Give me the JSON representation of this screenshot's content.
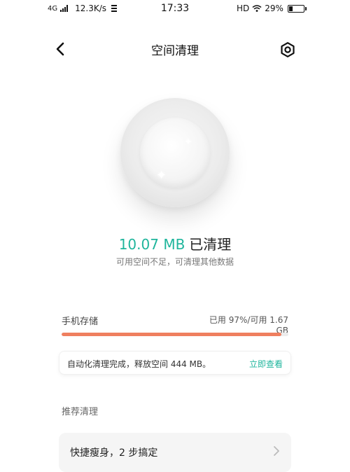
{
  "status_bar": {
    "network": "4G",
    "speed": "12.3K/s",
    "time": "17:33",
    "hd": "HD",
    "battery": "29%"
  },
  "header": {
    "title": "空间清理",
    "back_icon": "chevron-left-icon",
    "settings_icon": "gear-icon"
  },
  "result": {
    "amount": "10.07 MB",
    "suffix": "已清理",
    "subtitle": "可用空间不足，可清理其他数据"
  },
  "storage": {
    "label": "手机存储",
    "stats": "已用 97%/可用 1.67 GB",
    "used_fraction": 0.97
  },
  "auto_clean": {
    "text": "自动化清理完成，释放空间 444 MB。",
    "link": "立即查看"
  },
  "recommend": {
    "title": "推荐清理",
    "items": [
      {
        "label": "快捷瘦身，2 步搞定"
      }
    ]
  },
  "colors": {
    "accent": "#1fb59c",
    "storage_bar": "#ef7f5f"
  }
}
